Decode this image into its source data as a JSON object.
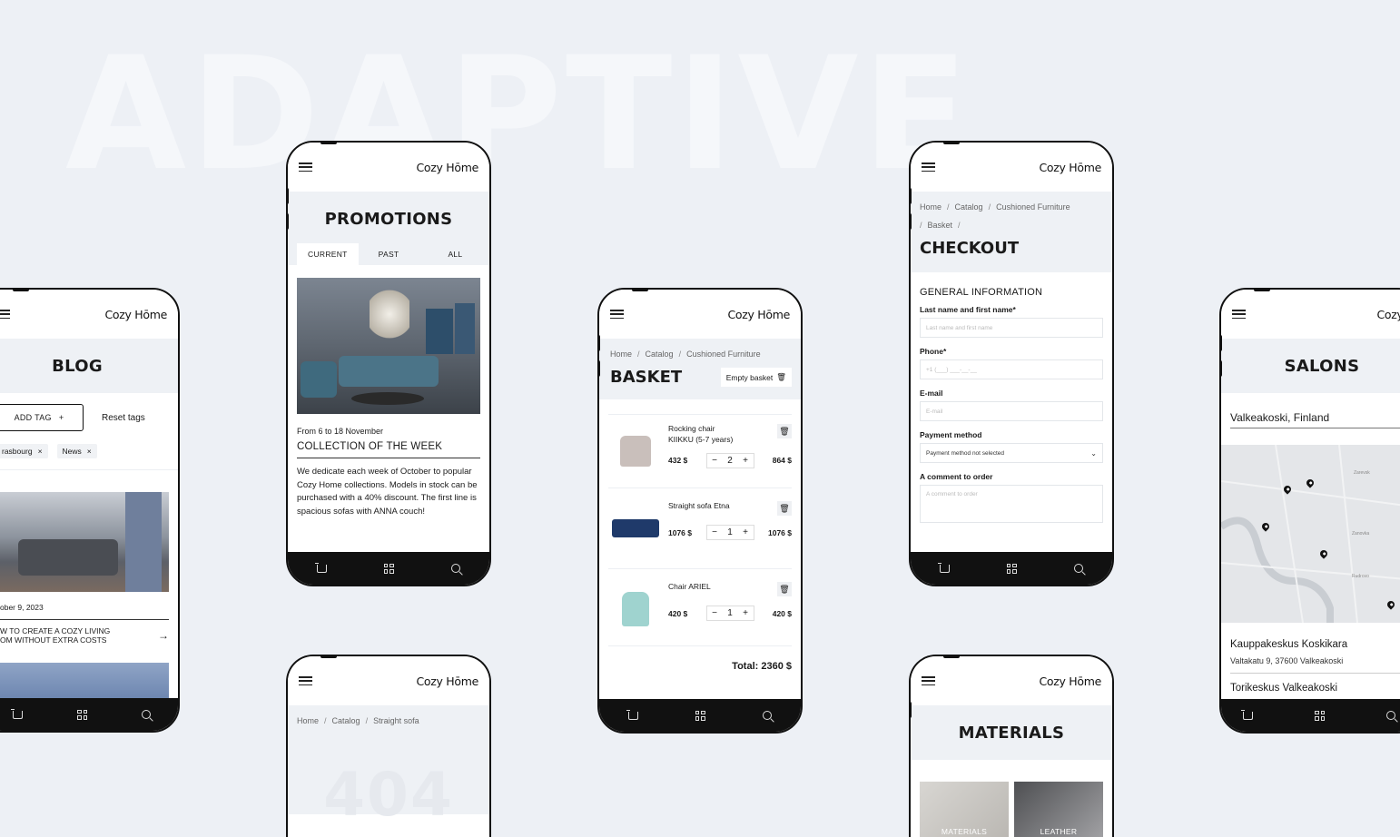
{
  "background_word": "ADAPTIVE",
  "brand": "Cozy Hōme",
  "blog": {
    "title": "BLOG",
    "add_tag": "ADD TAG",
    "add_tag_icon": "+",
    "reset_tags": "Reset tags",
    "tags": [
      {
        "label": "rasbourg",
        "remove": "×"
      },
      {
        "label": "News",
        "remove": "×"
      }
    ],
    "post_date": "ober 9, 2023",
    "post_title_line1": "W TO CREATE A COZY LIVING",
    "post_title_line2": "OM WITHOUT EXTRA COSTS",
    "arrow": "→"
  },
  "promotions": {
    "title": "PROMOTIONS",
    "tabs": [
      "CURRENT",
      "PAST",
      "ALL"
    ],
    "date": "From 6 to 18 November",
    "heading": "COLLECTION OF THE WEEK",
    "body": "We dedicate each week of October to popular Cozy Home collections. Models in stock can be purchased with a 40% discount. The first line is spacious sofas with ANNA couch!"
  },
  "notfound": {
    "crumbs": [
      "Home",
      "Catalog",
      "Straight sofa"
    ],
    "code": "404"
  },
  "basket": {
    "crumbs": [
      "Home",
      "Catalog",
      "Cushioned Furniture"
    ],
    "title": "BASKET",
    "empty_label": "Empty basket",
    "items": [
      {
        "name1": "Rocking chair",
        "name2": "KIIKKU (5-7 years)",
        "price": "432 $",
        "qty": "2",
        "total": "864 $"
      },
      {
        "name1": "Straight sofa Etna",
        "name2": "",
        "price": "1076 $",
        "qty": "1",
        "total": "1076 $"
      },
      {
        "name1": "Chair ARIEL",
        "name2": "",
        "price": "420 $",
        "qty": "1",
        "total": "420 $"
      }
    ],
    "minus": "−",
    "plus": "+",
    "total": "Total: 2360 $"
  },
  "checkout": {
    "crumbs_line1": [
      "Home",
      "Catalog",
      "Cushioned Furniture"
    ],
    "crumbs_line2": [
      "Basket"
    ],
    "title": "CHECKOUT",
    "section": "GENERAL INFORMATION",
    "fields": [
      {
        "label": "Last name and first name*",
        "placeholder": "Last name and first name"
      },
      {
        "label": "Phone*",
        "placeholder": "+1 (___) ___-__-__"
      },
      {
        "label": "E-mail",
        "placeholder": "E-mail"
      }
    ],
    "payment_label": "Payment method",
    "payment_value": "Payment method not selected",
    "comment_label": "A comment to order",
    "comment_placeholder": "A comment to order"
  },
  "materials": {
    "title": "MATERIALS",
    "cards": [
      "MATERIALS",
      "LEATHER"
    ]
  },
  "salons": {
    "title": "SALONS",
    "city": "Valkeakoski, Finland",
    "map_labels": [
      "Zarevsk",
      "Zanovka",
      "Rudrovo"
    ],
    "first_name": "Kauppakeskus Koskikara",
    "first_address": "Valtakatu 9, 37600 Valkeakoski",
    "second_name": "Torikeskus Valkeakoski"
  },
  "colors": {
    "accent": "#111111",
    "panel": "#eef1f5",
    "background": "#edf0f5"
  }
}
